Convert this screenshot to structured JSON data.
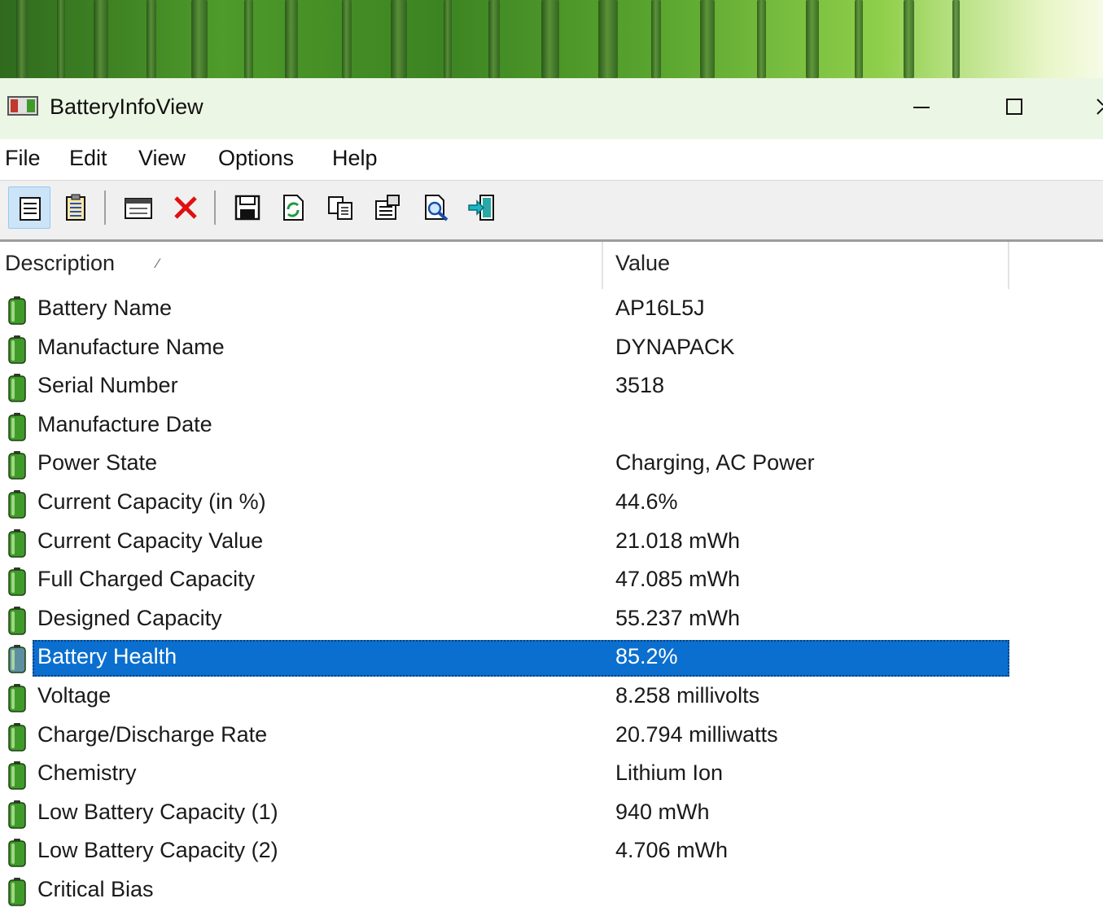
{
  "window": {
    "title": "BatteryInfoView",
    "app_icon": "battery-app-icon",
    "controls": [
      "minimize-icon",
      "maximize-icon",
      "close-icon"
    ]
  },
  "menu": {
    "items": [
      "File",
      "Edit",
      "View",
      "Options",
      "Help"
    ]
  },
  "toolbar": {
    "buttons": [
      {
        "icon": "battery-info-view-icon",
        "active": true
      },
      {
        "icon": "log-view-icon",
        "active": false
      },
      {
        "icon": "properties-window-icon",
        "active": false
      },
      {
        "icon": "delete-icon",
        "active": false
      },
      {
        "icon": "save-icon",
        "active": false
      },
      {
        "icon": "refresh-icon",
        "active": false
      },
      {
        "icon": "copy-icon",
        "active": false
      },
      {
        "icon": "properties-icon",
        "active": false
      },
      {
        "icon": "find-icon",
        "active": false
      },
      {
        "icon": "exit-icon",
        "active": false
      }
    ]
  },
  "list": {
    "columns": [
      "Description",
      "Value"
    ],
    "sort_column": "Description",
    "selected_index": 9,
    "rows": [
      {
        "description": "Battery Name",
        "value": "AP16L5J"
      },
      {
        "description": "Manufacture Name",
        "value": "DYNAPACK"
      },
      {
        "description": "Serial Number",
        "value": "3518"
      },
      {
        "description": "Manufacture Date",
        "value": ""
      },
      {
        "description": "Power State",
        "value": "Charging, AC Power"
      },
      {
        "description": "Current Capacity (in %)",
        "value": "44.6%"
      },
      {
        "description": "Current Capacity Value",
        "value": "21.018 mWh"
      },
      {
        "description": "Full Charged Capacity",
        "value": "47.085 mWh"
      },
      {
        "description": "Designed Capacity",
        "value": "55.237 mWh"
      },
      {
        "description": "Battery Health",
        "value": "85.2%"
      },
      {
        "description": "Voltage",
        "value": "8.258 millivolts"
      },
      {
        "description": "Charge/Discharge Rate",
        "value": "20.794 milliwatts"
      },
      {
        "description": "Chemistry",
        "value": "Lithium Ion"
      },
      {
        "description": "Low Battery Capacity (1)",
        "value": "940 mWh"
      },
      {
        "description": "Low Battery Capacity (2)",
        "value": "4.706 mWh"
      },
      {
        "description": "Critical Bias",
        "value": ""
      }
    ]
  },
  "colors": {
    "titlebar": "#ecf6e4",
    "selection": "#0a6fcf",
    "battery_green": "#3f9a2a"
  }
}
